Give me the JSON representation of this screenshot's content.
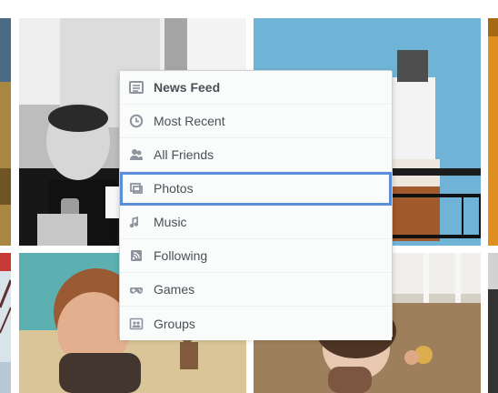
{
  "menu": {
    "items": [
      {
        "label": "News Feed",
        "icon": "news-feed-icon",
        "state": "active"
      },
      {
        "label": "Most Recent",
        "icon": "clock-icon",
        "state": "normal"
      },
      {
        "label": "All Friends",
        "icon": "friends-icon",
        "state": "normal"
      },
      {
        "label": "Photos",
        "icon": "photos-icon",
        "state": "selected"
      },
      {
        "label": "Music",
        "icon": "music-icon",
        "state": "normal"
      },
      {
        "label": "Following",
        "icon": "rss-icon",
        "state": "normal"
      },
      {
        "label": "Games",
        "icon": "games-icon",
        "state": "normal"
      },
      {
        "label": "Groups",
        "icon": "groups-icon",
        "state": "normal"
      }
    ]
  },
  "colors": {
    "selection": "#5b8ddd",
    "menu_text": "#4b4f56",
    "icon": "#8d949e"
  }
}
